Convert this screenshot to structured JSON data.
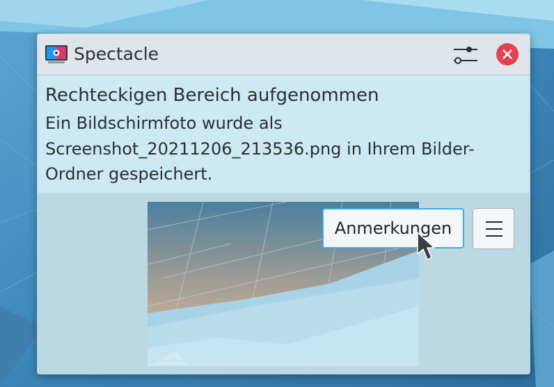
{
  "app": {
    "name": "Spectacle",
    "icon": "spectacle-app-icon"
  },
  "header": {
    "configure_icon": "configure-sliders-icon",
    "close_icon": "close-icon"
  },
  "notification": {
    "summary": "Rechteckigen Bereich aufgenommen",
    "body_lines": [
      "Ein Bildschirmfoto wurde als",
      "Screenshot_20211206_213536.png in Ihrem Bilder-",
      "Ordner gespeichert."
    ]
  },
  "actions": {
    "annotate_label": "Anmerkungen",
    "menu_icon": "hamburger-menu-icon"
  },
  "colors": {
    "close": "#e34154",
    "focus_border": "#3daee9",
    "panel": "#cde9f1",
    "header": "#dfe5e8"
  }
}
